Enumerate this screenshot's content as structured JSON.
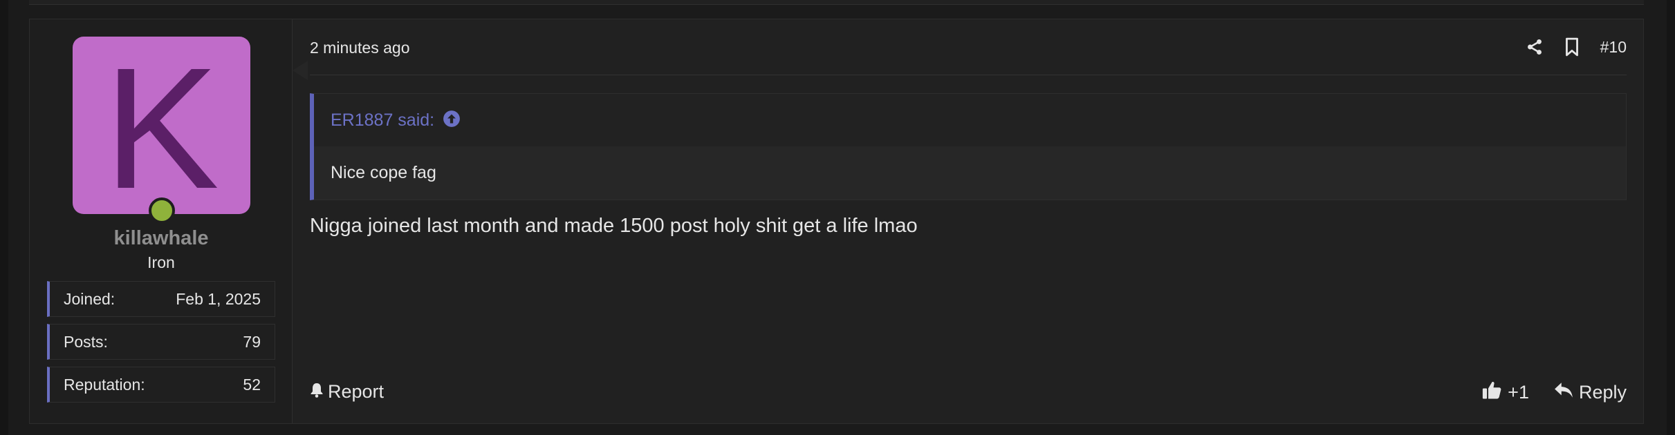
{
  "post": {
    "time": "2 minutes ago",
    "number": "#10",
    "quote": {
      "author": "ER1887 said:",
      "text": "Nice cope fag"
    },
    "message": "Nigga joined last month and made 1500 post holy shit get a life lmao"
  },
  "user": {
    "avatar_letter": "K",
    "avatar_color": "#c06cc9",
    "online_color": "#8fb23b",
    "username": "killawhale",
    "title": "Iron",
    "stats": {
      "joined_label": "Joined:",
      "joined_value": "Feb 1, 2025",
      "posts_label": "Posts:",
      "posts_value": "79",
      "reputation_label": "Reputation:",
      "reputation_value": "52"
    }
  },
  "actions": {
    "report_label": "Report",
    "like_count": "+1",
    "reply_label": "Reply"
  },
  "icons": {
    "share": "share-icon",
    "bookmark": "bookmark-icon",
    "quote_jump": "arrow-circle-up-icon",
    "report": "bell-icon",
    "like": "thumbs-up-icon",
    "reply": "reply-arrow-icon"
  },
  "colors": {
    "accent": "#6a6fc2",
    "background": "#212121"
  }
}
